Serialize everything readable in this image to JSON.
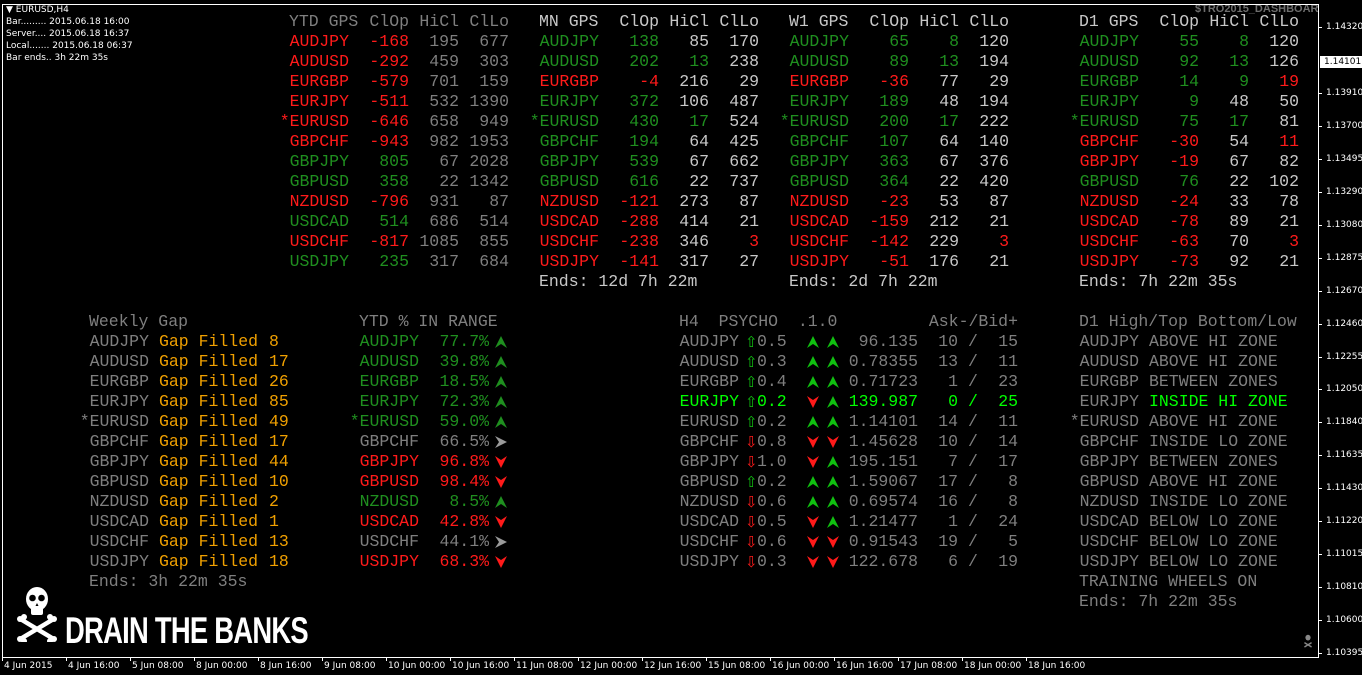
{
  "palette": {
    "red": "#ff1a1a",
    "green": "#1f8f1f",
    "lime": "#00ff00",
    "gray": "#7f7f7f",
    "light": "#c8c8c8",
    "orange": "#f0a000",
    "arrow_green": "#10c010",
    "arrow_red": "#ff1a1a"
  },
  "chart": {
    "symbol": "EURUSD,H4",
    "info": [
      "Bar......... 2015.06.18 16:00",
      "Server.... 2015.06.18 16:37",
      "Local....... 2015.06.18 06:37",
      "Bar ends.. 3h 22m 35s"
    ],
    "indicator_name": "$TRO2015_DASHBOARD",
    "current_price": "1.14101",
    "price_labels": [
      "1.14320",
      "1.13910",
      "1.13700",
      "1.13495",
      "1.13290",
      "1.13080",
      "1.12875",
      "1.12670",
      "1.12460",
      "1.12255",
      "1.12050",
      "1.11840",
      "1.11635",
      "1.11430",
      "1.11220",
      "1.11015",
      "1.10810",
      "1.10600",
      "1.10395"
    ],
    "time_labels": [
      "4 Jun 2015",
      "4 Jun 16:00",
      "5 Jun 08:00",
      "8 Jun 00:00",
      "8 Jun 16:00",
      "9 Jun 08:00",
      "10 Jun 00:00",
      "10 Jun 16:00",
      "11 Jun 08:00",
      "12 Jun 00:00",
      "12 Jun 16:00",
      "15 Jun 08:00",
      "16 Jun 00:00",
      "16 Jun 16:00",
      "17 Jun 08:00",
      "18 Jun 00:00",
      "18 Jun 16:00"
    ]
  },
  "logo": {
    "text": "DRAIN THE BANKS",
    "icon": "skull-crossbones-icon"
  },
  "gps_tables": [
    {
      "title": "YTD GPS",
      "header_color": "gray",
      "cols": [
        "ClOp",
        "HiCl",
        "ClLo"
      ],
      "ends": "",
      "rows": [
        {
          "pair": "AUDJPY",
          "c": "red",
          "clop": "-168",
          "hicl": "195",
          "hc": "gray",
          "cllo": "677",
          "lc": "gray"
        },
        {
          "pair": "AUDUSD",
          "c": "red",
          "clop": "-292",
          "hicl": "459",
          "hc": "gray",
          "cllo": "303",
          "lc": "gray"
        },
        {
          "pair": "EURGBP",
          "c": "red",
          "clop": "-579",
          "hicl": "701",
          "hc": "gray",
          "cllo": "159",
          "lc": "gray"
        },
        {
          "pair": "EURJPY",
          "c": "red",
          "clop": "-511",
          "hicl": "532",
          "hc": "gray",
          "cllo": "1390",
          "lc": "gray"
        },
        {
          "pair": "*EURUSD",
          "c": "red",
          "clop": "-646",
          "hicl": "658",
          "hc": "gray",
          "cllo": "949",
          "lc": "gray"
        },
        {
          "pair": "GBPCHF",
          "c": "red",
          "clop": "-943",
          "hicl": "982",
          "hc": "gray",
          "cllo": "1953",
          "lc": "gray"
        },
        {
          "pair": "GBPJPY",
          "c": "green",
          "clop": "805",
          "hicl": "67",
          "hc": "gray",
          "cllo": "2028",
          "lc": "gray"
        },
        {
          "pair": "GBPUSD",
          "c": "green",
          "clop": "358",
          "hicl": "22",
          "hc": "gray",
          "cllo": "1342",
          "lc": "gray"
        },
        {
          "pair": "NZDUSD",
          "c": "red",
          "clop": "-796",
          "hicl": "931",
          "hc": "gray",
          "cllo": "87",
          "lc": "gray"
        },
        {
          "pair": "USDCAD",
          "c": "green",
          "clop": "514",
          "hicl": "686",
          "hc": "gray",
          "cllo": "514",
          "lc": "gray"
        },
        {
          "pair": "USDCHF",
          "c": "red",
          "clop": "-817",
          "hicl": "1085",
          "hc": "gray",
          "cllo": "855",
          "lc": "gray"
        },
        {
          "pair": "USDJPY",
          "c": "green",
          "clop": "235",
          "hicl": "317",
          "hc": "gray",
          "cllo": "684",
          "lc": "gray"
        }
      ]
    },
    {
      "title": "MN GPS",
      "header_color": "light",
      "cols": [
        "ClOp",
        "HiCl",
        "ClLo"
      ],
      "ends": "Ends: 12d 7h 22m",
      "rows": [
        {
          "pair": "AUDJPY",
          "c": "green",
          "clop": "138",
          "hicl": "85",
          "hc": "light",
          "cllo": "170",
          "lc": "light"
        },
        {
          "pair": "AUDUSD",
          "c": "green",
          "clop": "202",
          "hicl": "13",
          "hc": "green",
          "cllo": "238",
          "lc": "light"
        },
        {
          "pair": "EURGBP",
          "c": "red",
          "clop": "-4",
          "hicl": "216",
          "hc": "light",
          "cllo": "29",
          "lc": "light"
        },
        {
          "pair": "EURJPY",
          "c": "green",
          "clop": "372",
          "hicl": "106",
          "hc": "light",
          "cllo": "487",
          "lc": "light"
        },
        {
          "pair": "*EURUSD",
          "c": "green",
          "clop": "430",
          "hicl": "17",
          "hc": "green",
          "cllo": "524",
          "lc": "light"
        },
        {
          "pair": "GBPCHF",
          "c": "green",
          "clop": "194",
          "hicl": "64",
          "hc": "light",
          "cllo": "425",
          "lc": "light"
        },
        {
          "pair": "GBPJPY",
          "c": "green",
          "clop": "539",
          "hicl": "67",
          "hc": "light",
          "cllo": "662",
          "lc": "light"
        },
        {
          "pair": "GBPUSD",
          "c": "green",
          "clop": "616",
          "hicl": "22",
          "hc": "light",
          "cllo": "737",
          "lc": "light"
        },
        {
          "pair": "NZDUSD",
          "c": "red",
          "clop": "-121",
          "hicl": "273",
          "hc": "light",
          "cllo": "87",
          "lc": "light"
        },
        {
          "pair": "USDCAD",
          "c": "red",
          "clop": "-288",
          "hicl": "414",
          "hc": "light",
          "cllo": "21",
          "lc": "light"
        },
        {
          "pair": "USDCHF",
          "c": "red",
          "clop": "-238",
          "hicl": "346",
          "hc": "light",
          "cllo": "3",
          "lc": "red"
        },
        {
          "pair": "USDJPY",
          "c": "red",
          "clop": "-141",
          "hicl": "317",
          "hc": "light",
          "cllo": "27",
          "lc": "light"
        }
      ]
    },
    {
      "title": "W1 GPS",
      "header_color": "light",
      "cols": [
        "ClOp",
        "HiCl",
        "ClLo"
      ],
      "ends": "Ends: 2d 7h 22m",
      "rows": [
        {
          "pair": "AUDJPY",
          "c": "green",
          "clop": "65",
          "hicl": "8",
          "hc": "green",
          "cllo": "120",
          "lc": "light"
        },
        {
          "pair": "AUDUSD",
          "c": "green",
          "clop": "89",
          "hicl": "13",
          "hc": "green",
          "cllo": "194",
          "lc": "light"
        },
        {
          "pair": "EURGBP",
          "c": "red",
          "clop": "-36",
          "hicl": "77",
          "hc": "light",
          "cllo": "29",
          "lc": "light"
        },
        {
          "pair": "EURJPY",
          "c": "green",
          "clop": "189",
          "hicl": "48",
          "hc": "light",
          "cllo": "194",
          "lc": "light"
        },
        {
          "pair": "*EURUSD",
          "c": "green",
          "clop": "200",
          "hicl": "17",
          "hc": "green",
          "cllo": "222",
          "lc": "light"
        },
        {
          "pair": "GBPCHF",
          "c": "green",
          "clop": "107",
          "hicl": "64",
          "hc": "light",
          "cllo": "140",
          "lc": "light"
        },
        {
          "pair": "GBPJPY",
          "c": "green",
          "clop": "363",
          "hicl": "67",
          "hc": "light",
          "cllo": "376",
          "lc": "light"
        },
        {
          "pair": "GBPUSD",
          "c": "green",
          "clop": "364",
          "hicl": "22",
          "hc": "light",
          "cllo": "420",
          "lc": "light"
        },
        {
          "pair": "NZDUSD",
          "c": "red",
          "clop": "-23",
          "hicl": "53",
          "hc": "light",
          "cllo": "87",
          "lc": "light"
        },
        {
          "pair": "USDCAD",
          "c": "red",
          "clop": "-159",
          "hicl": "212",
          "hc": "light",
          "cllo": "21",
          "lc": "light"
        },
        {
          "pair": "USDCHF",
          "c": "red",
          "clop": "-142",
          "hicl": "229",
          "hc": "light",
          "cllo": "3",
          "lc": "red"
        },
        {
          "pair": "USDJPY",
          "c": "red",
          "clop": "-51",
          "hicl": "176",
          "hc": "light",
          "cllo": "21",
          "lc": "light"
        }
      ]
    },
    {
      "title": "D1 GPS",
      "header_color": "light",
      "cols": [
        "ClOp",
        "HiCl",
        "ClLo"
      ],
      "ends": "Ends: 7h 22m 35s",
      "rows": [
        {
          "pair": "AUDJPY",
          "c": "green",
          "clop": "55",
          "hicl": "8",
          "hc": "green",
          "cllo": "120",
          "lc": "light"
        },
        {
          "pair": "AUDUSD",
          "c": "green",
          "clop": "92",
          "hicl": "13",
          "hc": "green",
          "cllo": "126",
          "lc": "light"
        },
        {
          "pair": "EURGBP",
          "c": "green",
          "clop": "14",
          "hicl": "9",
          "hc": "green",
          "cllo": "19",
          "lc": "red"
        },
        {
          "pair": "EURJPY",
          "c": "green",
          "clop": "9",
          "hicl": "48",
          "hc": "light",
          "cllo": "50",
          "lc": "light"
        },
        {
          "pair": "*EURUSD",
          "c": "green",
          "clop": "75",
          "hicl": "17",
          "hc": "green",
          "cllo": "81",
          "lc": "light"
        },
        {
          "pair": "GBPCHF",
          "c": "red",
          "clop": "-30",
          "hicl": "54",
          "hc": "light",
          "cllo": "11",
          "lc": "red"
        },
        {
          "pair": "GBPJPY",
          "c": "red",
          "clop": "-19",
          "hicl": "67",
          "hc": "light",
          "cllo": "82",
          "lc": "light"
        },
        {
          "pair": "GBPUSD",
          "c": "green",
          "clop": "76",
          "hicl": "22",
          "hc": "light",
          "cllo": "102",
          "lc": "light"
        },
        {
          "pair": "NZDUSD",
          "c": "red",
          "clop": "-24",
          "hicl": "33",
          "hc": "light",
          "cllo": "78",
          "lc": "light"
        },
        {
          "pair": "USDCAD",
          "c": "red",
          "clop": "-78",
          "hicl": "89",
          "hc": "light",
          "cllo": "21",
          "lc": "light"
        },
        {
          "pair": "USDCHF",
          "c": "red",
          "clop": "-63",
          "hicl": "70",
          "hc": "light",
          "cllo": "3",
          "lc": "red"
        },
        {
          "pair": "USDJPY",
          "c": "red",
          "clop": "-73",
          "hicl": "92",
          "hc": "light",
          "cllo": "21",
          "lc": "light"
        }
      ]
    }
  ],
  "weekly_gap": {
    "title": "Weekly Gap",
    "gap_label": "Gap Filled",
    "ends": "Ends: 3h 22m 35s",
    "rows": [
      {
        "pair": "AUDJPY",
        "count": "8"
      },
      {
        "pair": "AUDUSD",
        "count": "17"
      },
      {
        "pair": "EURGBP",
        "count": "26"
      },
      {
        "pair": "EURJPY",
        "count": "85"
      },
      {
        "pair": "*EURUSD",
        "count": "49"
      },
      {
        "pair": "GBPCHF",
        "count": "17"
      },
      {
        "pair": "GBPJPY",
        "count": "44"
      },
      {
        "pair": "GBPUSD",
        "count": "10"
      },
      {
        "pair": "NZDUSD",
        "count": "2"
      },
      {
        "pair": "USDCAD",
        "count": "1"
      },
      {
        "pair": "USDCHF",
        "count": "13"
      },
      {
        "pair": "USDJPY",
        "count": "18"
      }
    ]
  },
  "ytd_range": {
    "title": "YTD % IN RANGE",
    "rows": [
      {
        "pair": "AUDJPY",
        "pct": "77.7%",
        "c": "green",
        "arrow": "up"
      },
      {
        "pair": "AUDUSD",
        "pct": "39.8%",
        "c": "green",
        "arrow": "up"
      },
      {
        "pair": "EURGBP",
        "pct": "18.5%",
        "c": "green",
        "arrow": "up"
      },
      {
        "pair": "EURJPY",
        "pct": "72.3%",
        "c": "green",
        "arrow": "up"
      },
      {
        "pair": "*EURUSD",
        "pct": "59.0%",
        "c": "green",
        "arrow": "up"
      },
      {
        "pair": "GBPCHF",
        "pct": "66.5%",
        "c": "gray",
        "arrow": "right"
      },
      {
        "pair": "GBPJPY",
        "pct": "96.8%",
        "c": "red",
        "arrow": "down"
      },
      {
        "pair": "GBPUSD",
        "pct": "98.4%",
        "c": "red",
        "arrow": "down"
      },
      {
        "pair": "NZDUSD",
        "pct": "8.5%",
        "c": "green",
        "arrow": "up"
      },
      {
        "pair": "USDCAD",
        "pct": "42.8%",
        "c": "red",
        "arrow": "down"
      },
      {
        "pair": "USDCHF",
        "pct": "44.1%",
        "c": "gray",
        "arrow": "right"
      },
      {
        "pair": "USDJPY",
        "pct": "68.3%",
        "c": "red",
        "arrow": "down"
      }
    ]
  },
  "psycho": {
    "title": "H4  PSYCHO  .1.0",
    "ask_bid_label": "Ask-/Bid+",
    "separator": "/",
    "rows": [
      {
        "pair": "AUDJPY",
        "dir": "up",
        "val": "0.5",
        "a1": "up",
        "a2": "up",
        "price": "96.135",
        "ask": "10",
        "bid": "15",
        "c": "gray"
      },
      {
        "pair": "AUDUSD",
        "dir": "up",
        "val": "0.3",
        "a1": "up",
        "a2": "up",
        "price": "0.78355",
        "ask": "13",
        "bid": "11",
        "c": "gray"
      },
      {
        "pair": "EURGBP",
        "dir": "up",
        "val": "0.4",
        "a1": "up",
        "a2": "up",
        "price": "0.71723",
        "ask": "1",
        "bid": "23",
        "c": "gray"
      },
      {
        "pair": "EURJPY",
        "dir": "up",
        "val": "0.2",
        "a1": "down",
        "a2": "up",
        "price": "139.987",
        "ask": "0",
        "bid": "25",
        "c": "lime"
      },
      {
        "pair": "EURUSD",
        "dir": "up",
        "val": "0.2",
        "a1": "up",
        "a2": "up",
        "price": "1.14101",
        "ask": "14",
        "bid": "11",
        "c": "gray"
      },
      {
        "pair": "GBPCHF",
        "dir": "down",
        "val": "0.8",
        "a1": "down",
        "a2": "down",
        "price": "1.45628",
        "ask": "10",
        "bid": "14",
        "c": "gray"
      },
      {
        "pair": "GBPJPY",
        "dir": "down",
        "val": "1.0",
        "a1": "down",
        "a2": "up",
        "price": "195.151",
        "ask": "7",
        "bid": "17",
        "c": "gray"
      },
      {
        "pair": "GBPUSD",
        "dir": "up",
        "val": "0.2",
        "a1": "up",
        "a2": "up",
        "price": "1.59067",
        "ask": "17",
        "bid": "8",
        "c": "gray"
      },
      {
        "pair": "NZDUSD",
        "dir": "down",
        "val": "0.6",
        "a1": "up",
        "a2": "up",
        "price": "0.69574",
        "ask": "16",
        "bid": "8",
        "c": "gray"
      },
      {
        "pair": "USDCAD",
        "dir": "down",
        "val": "0.5",
        "a1": "down",
        "a2": "up",
        "price": "1.21477",
        "ask": "1",
        "bid": "24",
        "c": "gray"
      },
      {
        "pair": "USDCHF",
        "dir": "down",
        "val": "0.6",
        "a1": "down",
        "a2": "down",
        "price": "0.91543",
        "ask": "19",
        "bid": "5",
        "c": "gray"
      },
      {
        "pair": "USDJPY",
        "dir": "down",
        "val": "0.3",
        "a1": "down",
        "a2": "down",
        "price": "122.678",
        "ask": "6",
        "bid": "19",
        "c": "gray"
      }
    ]
  },
  "d1_zones": {
    "title": "D1 High/Top Bottom/Low",
    "footer": "TRAINING WHEELS ON",
    "ends": "Ends: 7h 22m 35s",
    "rows": [
      {
        "pair": "AUDJPY",
        "status": "ABOVE HI ZONE",
        "c": "gray"
      },
      {
        "pair": "AUDUSD",
        "status": "ABOVE HI ZONE",
        "c": "gray"
      },
      {
        "pair": "EURGBP",
        "status": "BETWEEN ZONES",
        "c": "gray"
      },
      {
        "pair": "EURJPY",
        "status": "INSIDE HI ZONE",
        "c": "lime"
      },
      {
        "pair": "*EURUSD",
        "status": "ABOVE HI ZONE",
        "c": "gray"
      },
      {
        "pair": "GBPCHF",
        "status": "INSIDE LO ZONE",
        "c": "gray"
      },
      {
        "pair": "GBPJPY",
        "status": "BETWEEN ZONES",
        "c": "gray"
      },
      {
        "pair": "GBPUSD",
        "status": "ABOVE HI ZONE",
        "c": "gray"
      },
      {
        "pair": "NZDUSD",
        "status": "INSIDE LO ZONE",
        "c": "gray"
      },
      {
        "pair": "USDCAD",
        "status": "BELOW LO ZONE",
        "c": "gray"
      },
      {
        "pair": "USDCHF",
        "status": "BELOW LO ZONE",
        "c": "gray"
      },
      {
        "pair": "USDJPY",
        "status": "BELOW LO ZONE",
        "c": "gray"
      }
    ]
  }
}
